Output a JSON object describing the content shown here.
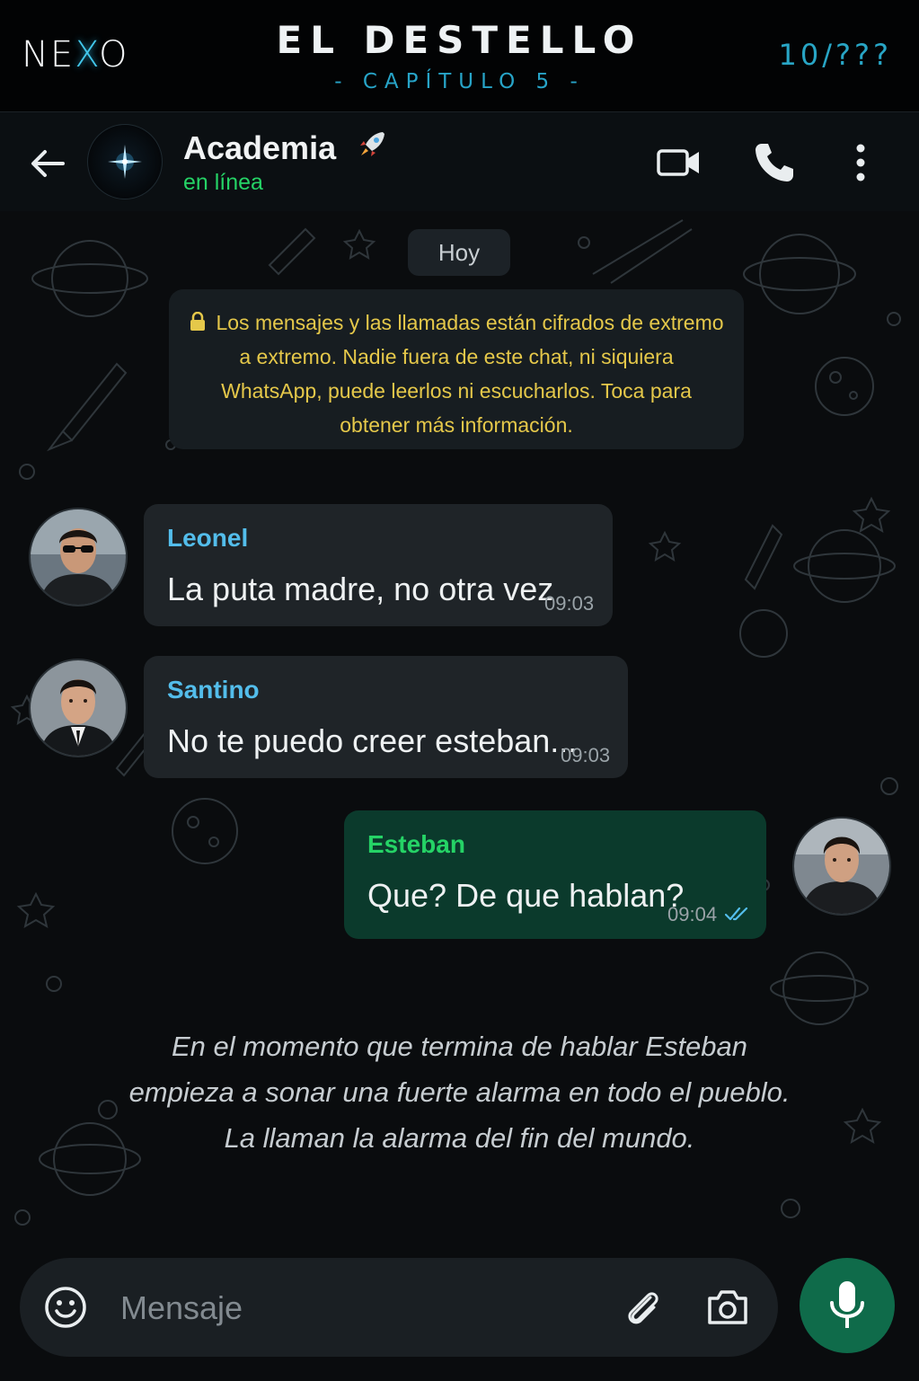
{
  "banner": {
    "logo": "NEXO",
    "title": "EL DESTELLO",
    "subtitle": "- CAPÍTULO 5 -",
    "counter": "10/???"
  },
  "header": {
    "group_name": "Academia",
    "group_emoji": "rocket-icon",
    "status": "en línea"
  },
  "chat": {
    "date": "Hoy",
    "encryption_notice": "Los mensajes y las llamadas están cifrados de extremo a extremo. Nadie fuera de este chat, ni siquiera WhatsApp, puede leerlos ni escucharlos. Toca para obtener más información.",
    "messages": [
      {
        "sender": "Leonel",
        "text": "La puta madre, no otra vez",
        "time": "09:03",
        "direction": "incoming",
        "sender_color": "#53bdeb"
      },
      {
        "sender": "Santino",
        "text": "No te puedo creer esteban...",
        "time": "09:03",
        "direction": "incoming",
        "sender_color": "#53bdeb"
      },
      {
        "sender": "Esteban",
        "text": "Que? De que hablan?",
        "time": "09:04",
        "direction": "outgoing",
        "sender_color": "#25d366",
        "ticks": "read"
      }
    ],
    "narration": [
      "En el momento que termina de hablar Esteban",
      "empieza a sonar una fuerte alarma en todo el pueblo.",
      "La llaman la alarma del fin del mundo."
    ]
  },
  "input": {
    "placeholder": "Mensaje"
  },
  "colors": {
    "accent": "#28a5c5",
    "online": "#25d366",
    "outgoing_bubble": "#0b3a2c",
    "incoming_bubble": "#1f2428",
    "notice_text": "#e5c84a",
    "mic_button": "#0f6b4a"
  }
}
